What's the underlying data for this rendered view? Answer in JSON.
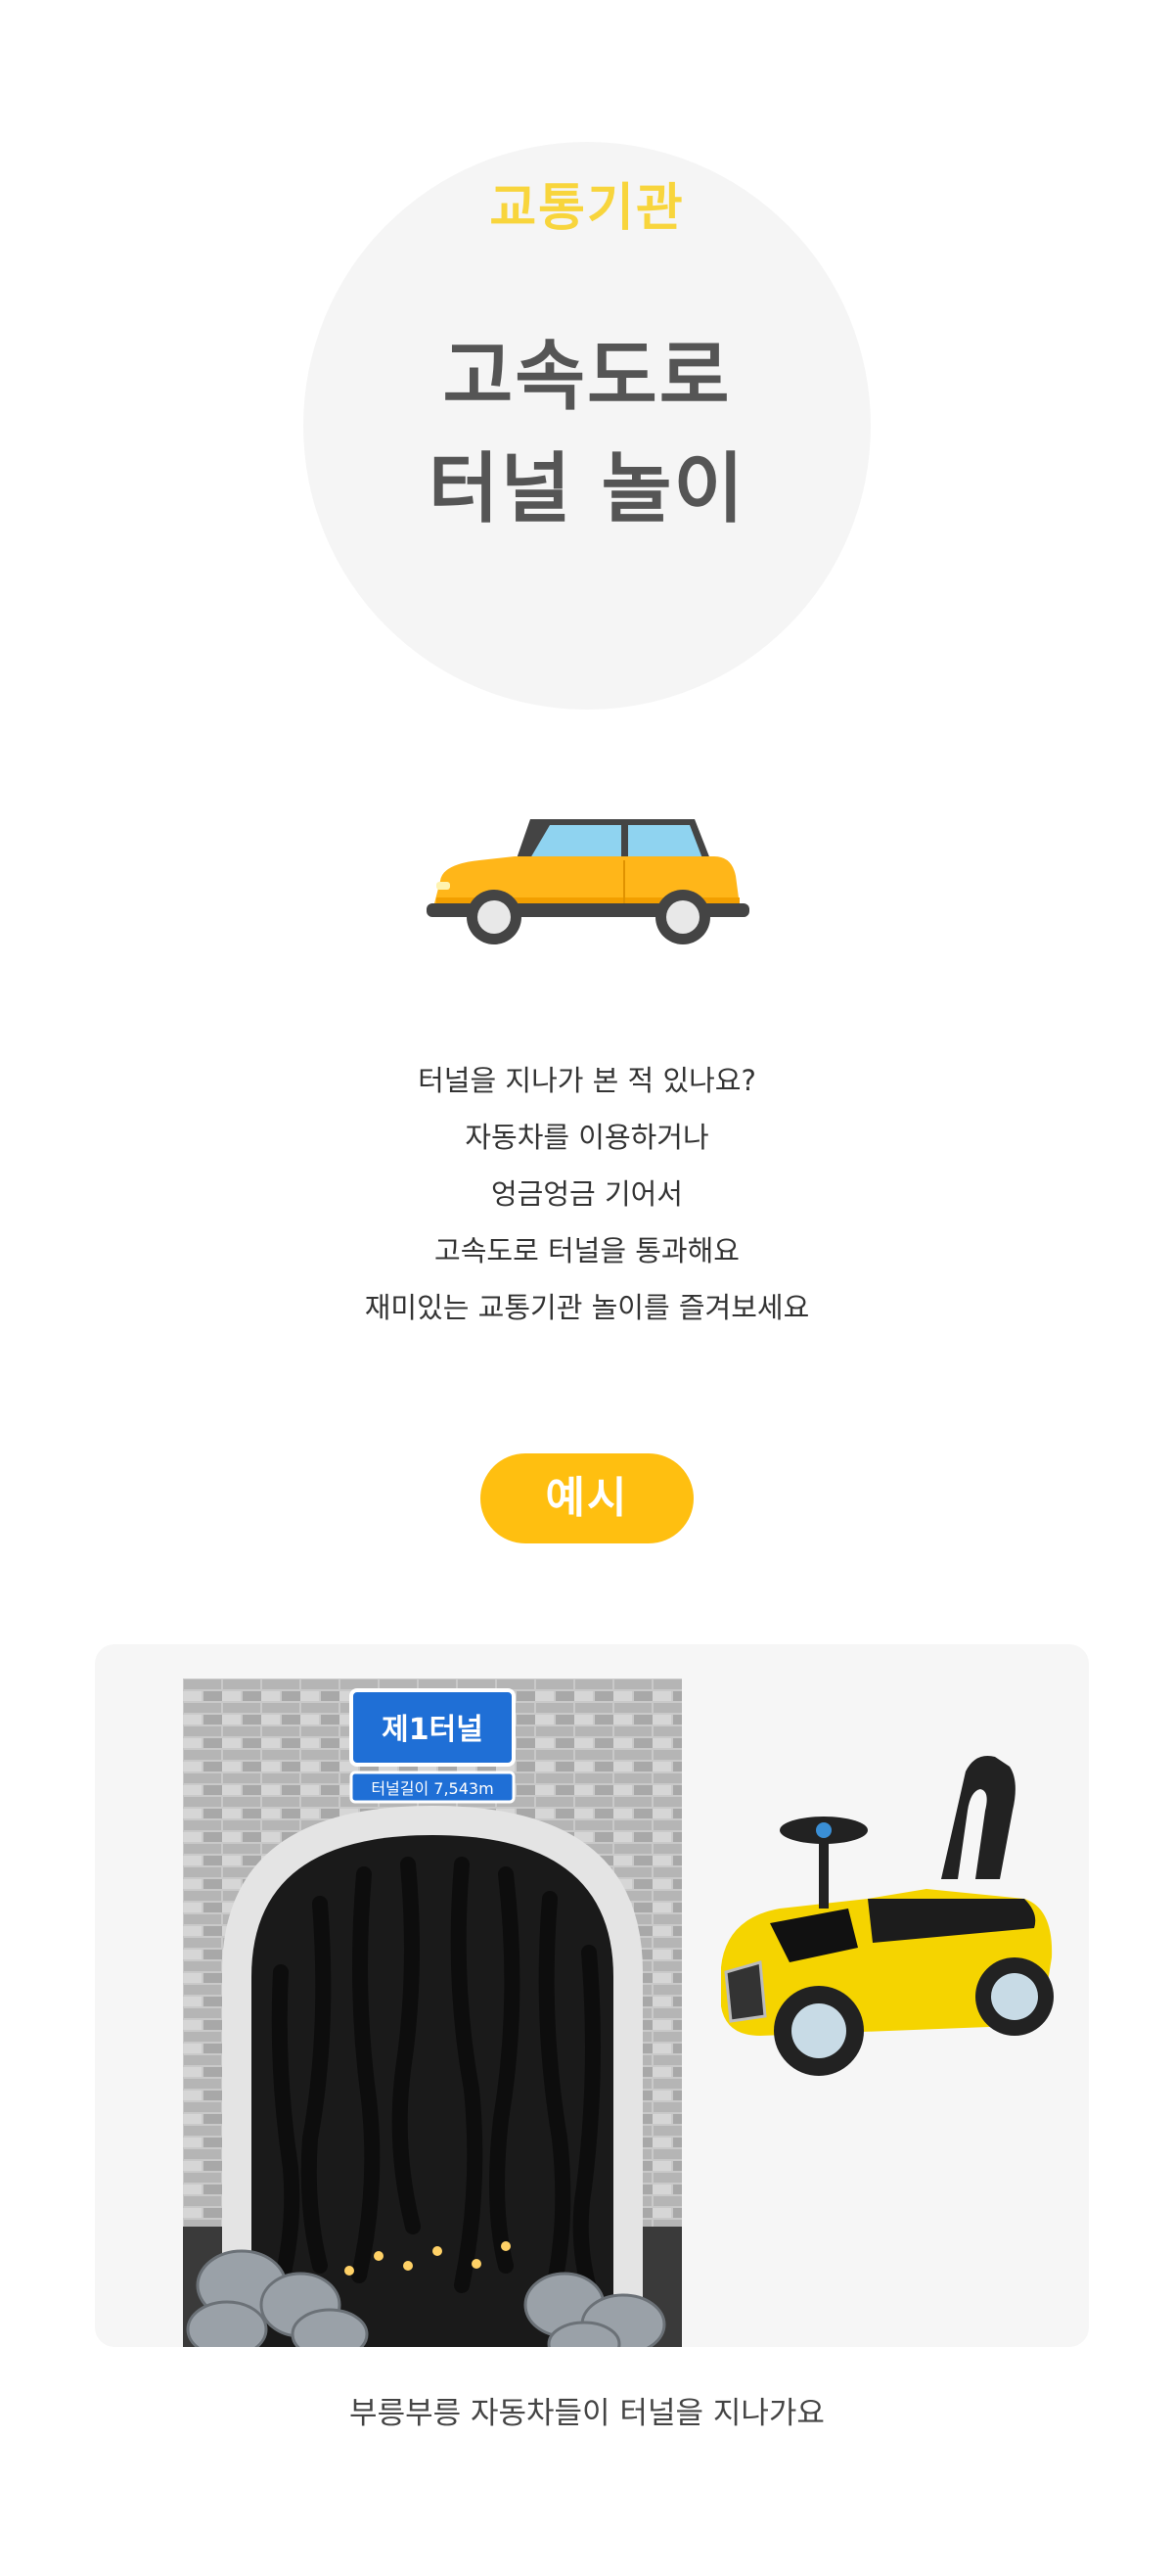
{
  "hero": {
    "category": "교통기관",
    "title_line1": "고속도로",
    "title_line2": "터널 놀이"
  },
  "description": [
    "터널을 지나가 본 적 있나요?",
    "자동차를 이용하거나",
    "엉금엉금 기어서",
    "고속도로 터널을 통과해요",
    "재미있는 교통기관 놀이를 즐겨보세요"
  ],
  "example_label": "예시",
  "photo": {
    "sign_name": "제1터널",
    "sign_length": "터널길이 7,543m"
  },
  "caption": "부릉부릉 자동차들이 터널을 지나가요",
  "colors": {
    "accent_yellow": "#ffbf10",
    "category_yellow": "#f8d53c",
    "title_gray": "#555555",
    "sign_blue": "#1f6fd6"
  },
  "icons": [
    "car-illustration",
    "tunnel-photo",
    "ride-on-car-photo"
  ]
}
